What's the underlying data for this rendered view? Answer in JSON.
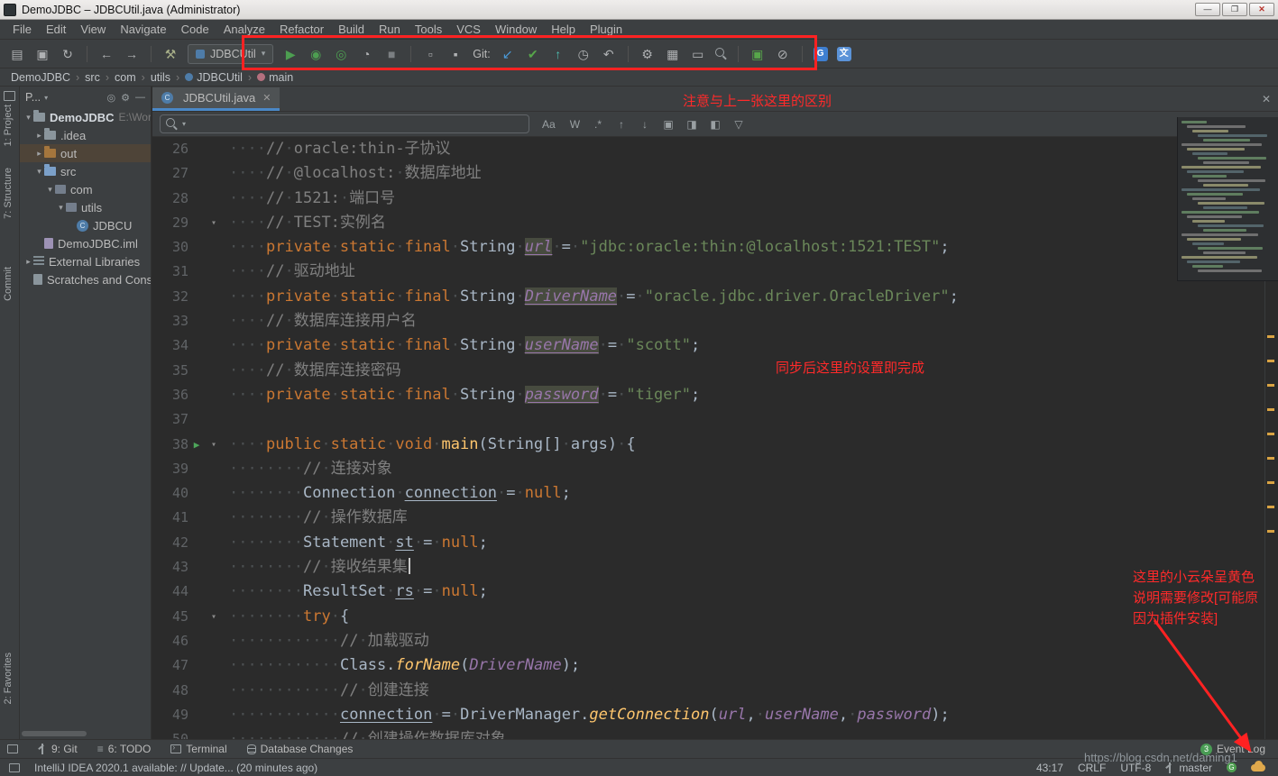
{
  "window": {
    "title": "DemoJDBC – JDBCUtil.java (Administrator)"
  },
  "menu": {
    "items": [
      "File",
      "Edit",
      "View",
      "Navigate",
      "Code",
      "Analyze",
      "Refactor",
      "Build",
      "Run",
      "Tools",
      "VCS",
      "Window",
      "Help",
      "Plugin"
    ]
  },
  "toolbar": {
    "run_config": "JDBCUtil",
    "git_label": "Git:",
    "items": [
      {
        "t": "i",
        "name": "open-icon",
        "g": "▤",
        "c": "#afb1b3"
      },
      {
        "t": "i",
        "name": "save-icon",
        "g": "▣",
        "c": "#afb1b3"
      },
      {
        "t": "i",
        "name": "sync-icon",
        "g": "↻",
        "c": "#afb1b3"
      },
      {
        "t": "sep"
      },
      {
        "t": "i",
        "name": "back-icon",
        "g": "←",
        "c": "#afb1b3"
      },
      {
        "t": "i",
        "name": "forward-icon",
        "g": "→",
        "c": "#afb1b3"
      },
      {
        "t": "sep"
      },
      {
        "t": "i",
        "name": "build-icon",
        "g": "⚒",
        "c": "#a8b089"
      },
      {
        "t": "combo",
        "name": "run-config-select"
      },
      {
        "t": "i",
        "name": "run-icon",
        "g": "▶",
        "c": "#4d9e51"
      },
      {
        "t": "i",
        "name": "debug-icon",
        "g": "◉",
        "c": "#4d9e51"
      },
      {
        "t": "i",
        "name": "coverage-icon",
        "g": "◎",
        "c": "#4d9e51"
      },
      {
        "t": "i",
        "name": "profiler-icon",
        "g": "◔",
        "c": "#afb1b3"
      },
      {
        "t": "i",
        "name": "stop-icon",
        "g": "■",
        "c": "#7b7f82"
      },
      {
        "t": "sep"
      },
      {
        "t": "i",
        "name": "run-anything-icon",
        "g": "▫",
        "c": "#afb1b3"
      },
      {
        "t": "i",
        "name": "recent-projects-icon",
        "g": "▪",
        "c": "#afb1b3"
      },
      {
        "t": "label",
        "name": "git-label"
      },
      {
        "t": "i",
        "name": "git-update-icon",
        "g": "↙",
        "c": "#4b9ad8"
      },
      {
        "t": "i",
        "name": "git-commit-icon",
        "g": "✔",
        "c": "#57a64a"
      },
      {
        "t": "i",
        "name": "git-push-icon",
        "g": "↑",
        "c": "#4dbdb0"
      },
      {
        "t": "i",
        "name": "history-icon",
        "g": "◷",
        "c": "#afb1b3"
      },
      {
        "t": "i",
        "name": "rollback-icon",
        "g": "↶",
        "c": "#afb1b3"
      },
      {
        "t": "sep"
      },
      {
        "t": "i",
        "name": "wrench-icon",
        "g": "⚙",
        "c": "#afb1b3"
      },
      {
        "t": "i",
        "name": "tool-folder-icon",
        "g": "▦",
        "c": "#afb1b3"
      },
      {
        "t": "i",
        "name": "console-icon",
        "g": "▭",
        "c": "#afb1b3"
      },
      {
        "t": "mag",
        "name": "search-icon"
      },
      {
        "t": "sep"
      },
      {
        "t": "i",
        "name": "markdown-icon",
        "g": "▣",
        "c": "#57a64a"
      },
      {
        "t": "i",
        "name": "power-save-icon",
        "g": "⊘",
        "c": "#afb1b3"
      },
      {
        "t": "sep"
      },
      {
        "t": "b",
        "name": "translate-icon-1",
        "g": "G",
        "c": "#3f7fd0"
      },
      {
        "t": "b",
        "name": "translate-icon-2",
        "g": "文",
        "c": "#5b93d8"
      }
    ]
  },
  "breadcrumbs": {
    "items": [
      "DemoJDBC",
      "src",
      "com",
      "utils",
      "JDBCUtil",
      "main"
    ]
  },
  "tool_strips": {
    "left_top": [
      "1: Project",
      "7: Structure",
      "Commit"
    ],
    "left_bottom": [
      "2: Favorites"
    ]
  },
  "project": {
    "header": "P...",
    "tree": [
      {
        "d": 0,
        "icon": "folder",
        "label": "DemoJDBC",
        "extra": "E:\\Wor",
        "arrow": "open",
        "root": true
      },
      {
        "d": 1,
        "icon": "folder",
        "label": ".idea",
        "arrow": "closed"
      },
      {
        "d": 1,
        "icon": "folderx",
        "label": "out",
        "arrow": "closed",
        "hl": true
      },
      {
        "d": 1,
        "icon": "foldersrc",
        "label": "src",
        "arrow": "open"
      },
      {
        "d": 2,
        "icon": "pkg",
        "label": "com",
        "arrow": "open"
      },
      {
        "d": 3,
        "icon": "pkg",
        "label": "utils",
        "arrow": "open"
      },
      {
        "d": 4,
        "icon": "class",
        "label": "JDBCU"
      },
      {
        "d": 1,
        "icon": "iml",
        "label": "DemoJDBC.iml"
      },
      {
        "d": 0,
        "icon": "lib",
        "label": "External Libraries",
        "arrow": "closed"
      },
      {
        "d": 0,
        "icon": "scratch",
        "label": "Scratches and Cons"
      }
    ]
  },
  "editor": {
    "tab": {
      "label": "JDBCUtil.java"
    },
    "search": {
      "toggles": [
        "Aa",
        "W",
        ".*"
      ]
    },
    "code": {
      "lines": [
        {
          "n": 26,
          "i": 4,
          "t": [
            [
              "cmt",
              "// oracle:thin-子协议"
            ]
          ]
        },
        {
          "n": 27,
          "i": 4,
          "t": [
            [
              "cmt",
              "// @localhost: 数据库地址"
            ]
          ]
        },
        {
          "n": 28,
          "i": 4,
          "t": [
            [
              "cmt",
              "// 1521: 端口号"
            ]
          ]
        },
        {
          "n": 29,
          "i": 4,
          "f": 1,
          "t": [
            [
              "cmt",
              "// TEST:实例名"
            ]
          ]
        },
        {
          "n": 30,
          "i": 4,
          "t": [
            [
              "kw",
              "private"
            ],
            [
              "pl",
              " "
            ],
            [
              "kw",
              "static"
            ],
            [
              "pl",
              " "
            ],
            [
              "kw",
              "final"
            ],
            [
              "pl",
              " String "
            ],
            [
              "fldh",
              "url"
            ],
            [
              "pl",
              " = "
            ],
            [
              "str",
              "\"jdbc:oracle:thin:@localhost:1521:TEST\""
            ],
            [
              "pl",
              ";"
            ]
          ]
        },
        {
          "n": 31,
          "i": 4,
          "t": [
            [
              "cmt",
              "// 驱动地址"
            ]
          ]
        },
        {
          "n": 32,
          "i": 4,
          "t": [
            [
              "kw",
              "private"
            ],
            [
              "pl",
              " "
            ],
            [
              "kw",
              "static"
            ],
            [
              "pl",
              " "
            ],
            [
              "kw",
              "final"
            ],
            [
              "pl",
              " String "
            ],
            [
              "fldh",
              "DriverName"
            ],
            [
              "pl",
              " = "
            ],
            [
              "str",
              "\"oracle.jdbc.driver.OracleDriver\""
            ],
            [
              "pl",
              ";"
            ]
          ]
        },
        {
          "n": 33,
          "i": 4,
          "t": [
            [
              "cmt",
              "// 数据库连接用户名"
            ]
          ]
        },
        {
          "n": 34,
          "i": 4,
          "t": [
            [
              "kw",
              "private"
            ],
            [
              "pl",
              " "
            ],
            [
              "kw",
              "static"
            ],
            [
              "pl",
              " "
            ],
            [
              "kw",
              "final"
            ],
            [
              "pl",
              " String "
            ],
            [
              "fldh",
              "userName"
            ],
            [
              "pl",
              " = "
            ],
            [
              "str",
              "\"scott\""
            ],
            [
              "pl",
              ";"
            ]
          ]
        },
        {
          "n": 35,
          "i": 4,
          "t": [
            [
              "cmt",
              "// 数据库连接密码"
            ]
          ]
        },
        {
          "n": 36,
          "i": 4,
          "t": [
            [
              "kw",
              "private"
            ],
            [
              "pl",
              " "
            ],
            [
              "kw",
              "static"
            ],
            [
              "pl",
              " "
            ],
            [
              "kw",
              "final"
            ],
            [
              "pl",
              " String "
            ],
            [
              "fldh",
              "password"
            ],
            [
              "pl",
              " = "
            ],
            [
              "str",
              "\"tiger\""
            ],
            [
              "pl",
              ";"
            ]
          ]
        },
        {
          "n": 37,
          "i": 0,
          "t": []
        },
        {
          "n": 38,
          "i": 4,
          "r": 1,
          "f": 1,
          "t": [
            [
              "kw",
              "public"
            ],
            [
              "pl",
              " "
            ],
            [
              "kw",
              "static"
            ],
            [
              "pl",
              " "
            ],
            [
              "kw",
              "void"
            ],
            [
              "pl",
              " "
            ],
            [
              "mtd",
              "main"
            ],
            [
              "pl",
              "(String[] args) {"
            ]
          ]
        },
        {
          "n": 39,
          "i": 8,
          "t": [
            [
              "cmt",
              "// 连接对象"
            ]
          ]
        },
        {
          "n": 40,
          "i": 8,
          "t": [
            [
              "pl",
              "Connection "
            ],
            [
              "var",
              "connection"
            ],
            [
              "pl",
              " = "
            ],
            [
              "kw",
              "null"
            ],
            [
              "pl",
              ";"
            ]
          ]
        },
        {
          "n": 41,
          "i": 8,
          "t": [
            [
              "cmt",
              "// 操作数据库"
            ]
          ]
        },
        {
          "n": 42,
          "i": 8,
          "t": [
            [
              "pl",
              "Statement "
            ],
            [
              "var",
              "st"
            ],
            [
              "pl",
              " = "
            ],
            [
              "kw",
              "null"
            ],
            [
              "pl",
              ";"
            ]
          ]
        },
        {
          "n": 43,
          "i": 8,
          "caret": 1,
          "t": [
            [
              "cmt",
              "// 接收结果集"
            ]
          ]
        },
        {
          "n": 44,
          "i": 8,
          "t": [
            [
              "pl",
              "ResultSet "
            ],
            [
              "var",
              "rs"
            ],
            [
              "pl",
              " = "
            ],
            [
              "kw",
              "null"
            ],
            [
              "pl",
              ";"
            ]
          ]
        },
        {
          "n": 45,
          "i": 8,
          "f": 1,
          "t": [
            [
              "kw",
              "try"
            ],
            [
              "pl",
              " {"
            ]
          ]
        },
        {
          "n": 46,
          "i": 12,
          "t": [
            [
              "cmt",
              "// 加载驱动"
            ]
          ]
        },
        {
          "n": 47,
          "i": 12,
          "t": [
            [
              "pl",
              "Class."
            ],
            [
              "call",
              "forName"
            ],
            [
              "pl",
              "("
            ],
            [
              "fld",
              "DriverName"
            ],
            [
              "pl",
              ");"
            ]
          ]
        },
        {
          "n": 48,
          "i": 12,
          "t": [
            [
              "cmt",
              "// 创建连接"
            ]
          ]
        },
        {
          "n": 49,
          "i": 12,
          "t": [
            [
              "var",
              "connection"
            ],
            [
              "pl",
              " = DriverManager."
            ],
            [
              "call",
              "getConnection"
            ],
            [
              "pl",
              "("
            ],
            [
              "fld",
              "url"
            ],
            [
              "pl",
              ", "
            ],
            [
              "fld",
              "userName"
            ],
            [
              "pl",
              ", "
            ],
            [
              "fld",
              "password"
            ],
            [
              "pl",
              ");"
            ]
          ]
        },
        {
          "n": 50,
          "i": 12,
          "t": [
            [
              "cmt",
              "// 创建操作数据库对象"
            ]
          ]
        }
      ]
    }
  },
  "annotations": {
    "toolbar_note": "注意与上一张这里的区别",
    "settings_note": "同步后这里的设置即完成",
    "cloud_note": [
      "这里的小云朵呈黄色",
      "说明需要修改[可能原",
      "因为插件安装]"
    ]
  },
  "bottom_bar": {
    "items": [
      "9: Git",
      "6: TODO",
      "Terminal",
      "Database Changes"
    ],
    "event_log": {
      "badge": "3",
      "label": "Event Log"
    }
  },
  "status_bar": {
    "message": "IntelliJ IDEA 2020.1 available: // Update... (20 minutes ago)",
    "position": "43:17",
    "line_ending": "CRLF",
    "encoding": "UTF-8",
    "branch": "master"
  },
  "watermark": {
    "text": "https://blog.csdn.net/daming1"
  },
  "colors": {
    "annotation_red": "#ff2222",
    "warning_stripe": "#d9a343",
    "accent_blue": "#4a88c7"
  }
}
